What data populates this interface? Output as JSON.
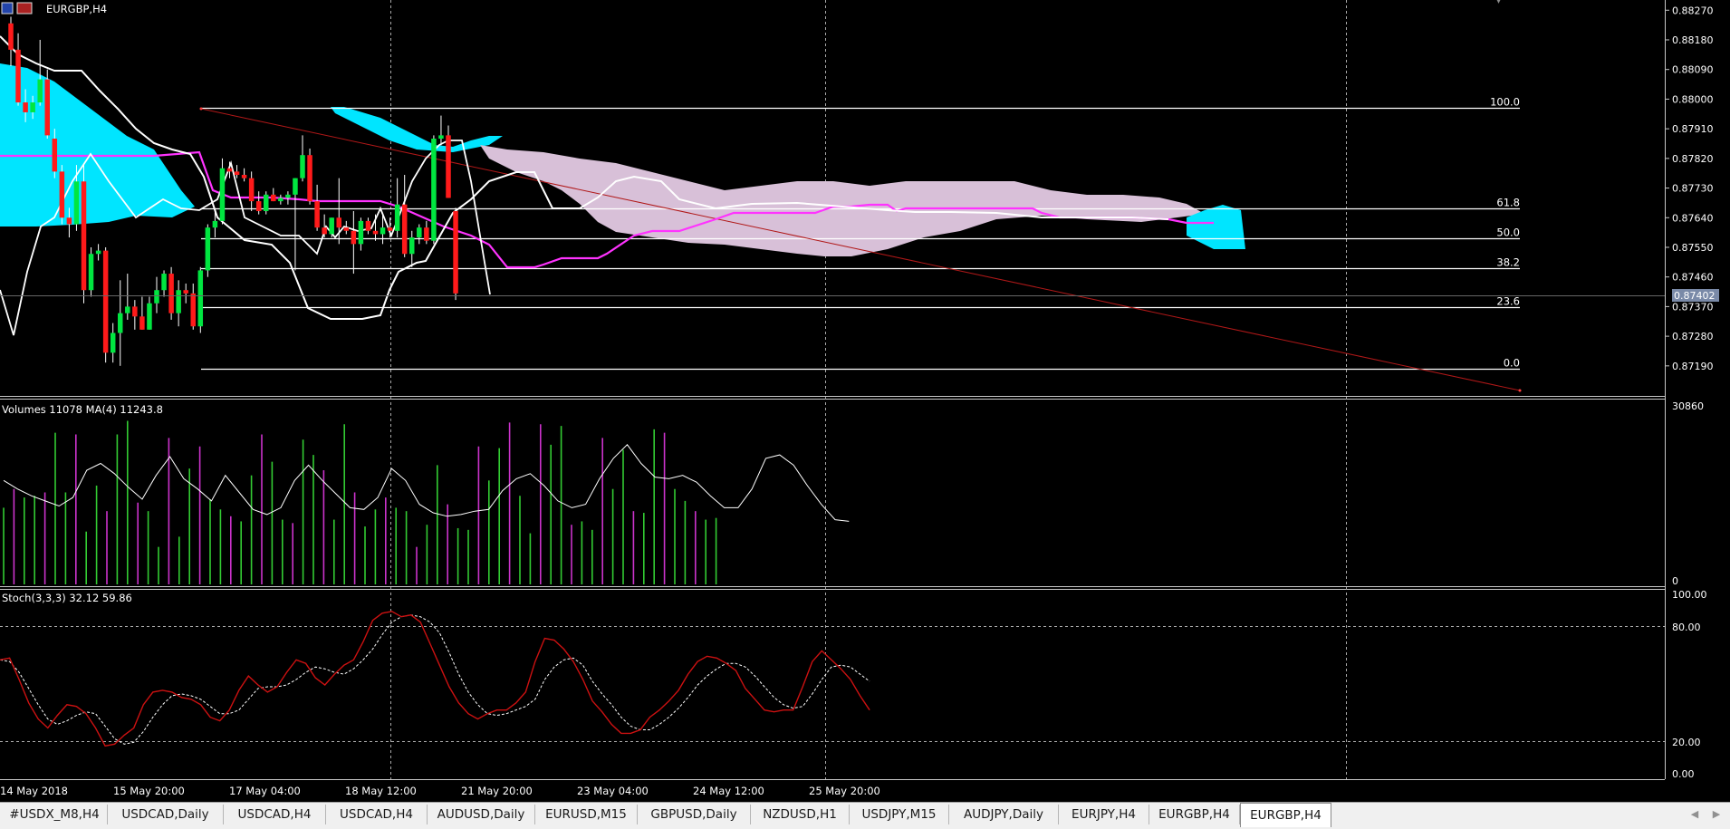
{
  "window": {
    "title": "EURGBP,H4"
  },
  "price_axis": {
    "labels": [
      "0.88270",
      "0.88180",
      "0.88090",
      "0.88000",
      "0.87910",
      "0.87820",
      "0.87730",
      "0.87640",
      "0.87550",
      "0.87460",
      "0.87370",
      "0.87280",
      "0.87190"
    ],
    "current_price": "0.87402"
  },
  "fib_levels": [
    {
      "label": "100.0",
      "value": 0.87973
    },
    {
      "label": "61.8",
      "value": 0.87669
    },
    {
      "label": "50.0",
      "value": 0.87577
    },
    {
      "label": "38.2",
      "value": 0.87486
    },
    {
      "label": "23.6",
      "value": 0.87367
    },
    {
      "label": "0.0",
      "value": 0.8718
    }
  ],
  "volume_panel": {
    "label": "Volumes 11078 MA(4) 11243.8",
    "max_label": "30860",
    "min_label": "0"
  },
  "stoch_panel": {
    "label": "Stoch(3,3,3) 32.12 59.86",
    "levels": [
      "100.00",
      "80.00",
      "20.00",
      "0.00"
    ]
  },
  "time_axis": {
    "labels": [
      "14 May 2018",
      "15 May 20:00",
      "17 May 04:00",
      "18 May 12:00",
      "21 May 20:00",
      "23 May 04:00",
      "24 May 12:00",
      "25 May 20:00"
    ]
  },
  "tabs": [
    {
      "label": "#USDX_M8,H4",
      "active": false
    },
    {
      "label": "USDCAD,Daily",
      "active": false
    },
    {
      "label": "USDCAD,H4",
      "active": false
    },
    {
      "label": "USDCAD,H4",
      "active": false
    },
    {
      "label": "AUDUSD,Daily",
      "active": false
    },
    {
      "label": "EURUSD,M15",
      "active": false
    },
    {
      "label": "GBPUSD,Daily",
      "active": false
    },
    {
      "label": "NZDUSD,H1",
      "active": false
    },
    {
      "label": "USDJPY,M15",
      "active": false
    },
    {
      "label": "AUDJPY,Daily",
      "active": false
    },
    {
      "label": "EURJPY,H4",
      "active": false
    },
    {
      "label": "EURGBP,H4",
      "active": false
    },
    {
      "label": "EURGBP,H4",
      "active": true
    }
  ],
  "colors": {
    "bull": "#00e640",
    "bear": "#ff1a1a",
    "kumo_bull": "#00e5ff",
    "kumo_bear": "#d8c0d8",
    "kijun": "#ff33ff",
    "fib_line": "#ffffff",
    "trend_line": "#b01818",
    "volume_up": "#33cc33",
    "volume_down": "#cc33cc",
    "stoch_main": "#cc1111",
    "stoch_signal": "#ffffff"
  },
  "chart_data": {
    "type": "candlestick",
    "title": "EURGBP,H4",
    "ylim": [
      0.8714,
      0.8829
    ],
    "candles": [
      {
        "o": 0.8823,
        "h": 0.8825,
        "l": 0.881,
        "c": 0.8815
      },
      {
        "o": 0.8815,
        "h": 0.882,
        "l": 0.8798,
        "c": 0.8799
      },
      {
        "o": 0.8799,
        "h": 0.8803,
        "l": 0.8793,
        "c": 0.8796
      },
      {
        "o": 0.8796,
        "h": 0.8801,
        "l": 0.8794,
        "c": 0.8799
      },
      {
        "o": 0.8799,
        "h": 0.8818,
        "l": 0.8798,
        "c": 0.8806
      },
      {
        "o": 0.8806,
        "h": 0.8809,
        "l": 0.8788,
        "c": 0.8789
      },
      {
        "o": 0.8788,
        "h": 0.8791,
        "l": 0.8776,
        "c": 0.8778
      },
      {
        "o": 0.8778,
        "h": 0.878,
        "l": 0.8762,
        "c": 0.8764
      },
      {
        "o": 0.8764,
        "h": 0.8767,
        "l": 0.8758,
        "c": 0.8762
      },
      {
        "o": 0.8762,
        "h": 0.878,
        "l": 0.876,
        "c": 0.8775
      },
      {
        "o": 0.8775,
        "h": 0.878,
        "l": 0.8738,
        "c": 0.8742
      },
      {
        "o": 0.8742,
        "h": 0.8755,
        "l": 0.874,
        "c": 0.8753
      },
      {
        "o": 0.8753,
        "h": 0.8756,
        "l": 0.8751,
        "c": 0.8754
      },
      {
        "o": 0.8754,
        "h": 0.8755,
        "l": 0.872,
        "c": 0.8723
      },
      {
        "o": 0.8723,
        "h": 0.8732,
        "l": 0.872,
        "c": 0.8729
      },
      {
        "o": 0.8729,
        "h": 0.8745,
        "l": 0.8719,
        "c": 0.8735
      },
      {
        "o": 0.8735,
        "h": 0.8747,
        "l": 0.8733,
        "c": 0.8737
      },
      {
        "o": 0.8737,
        "h": 0.8739,
        "l": 0.873,
        "c": 0.8734
      },
      {
        "o": 0.8734,
        "h": 0.874,
        "l": 0.873,
        "c": 0.873
      },
      {
        "o": 0.873,
        "h": 0.874,
        "l": 0.873,
        "c": 0.8738
      },
      {
        "o": 0.8738,
        "h": 0.8746,
        "l": 0.8735,
        "c": 0.8742
      },
      {
        "o": 0.8742,
        "h": 0.8748,
        "l": 0.874,
        "c": 0.8747
      },
      {
        "o": 0.8747,
        "h": 0.8749,
        "l": 0.8733,
        "c": 0.8735
      },
      {
        "o": 0.8735,
        "h": 0.8745,
        "l": 0.8731,
        "c": 0.8742
      },
      {
        "o": 0.8742,
        "h": 0.8744,
        "l": 0.8738,
        "c": 0.8741
      },
      {
        "o": 0.8741,
        "h": 0.8744,
        "l": 0.873,
        "c": 0.8731
      },
      {
        "o": 0.8731,
        "h": 0.8749,
        "l": 0.8729,
        "c": 0.8748
      },
      {
        "o": 0.8748,
        "h": 0.8762,
        "l": 0.8746,
        "c": 0.8761
      },
      {
        "o": 0.8761,
        "h": 0.8766,
        "l": 0.8758,
        "c": 0.8763
      },
      {
        "o": 0.8763,
        "h": 0.8782,
        "l": 0.8762,
        "c": 0.8779
      },
      {
        "o": 0.8779,
        "h": 0.8781,
        "l": 0.8776,
        "c": 0.8778
      },
      {
        "o": 0.8778,
        "h": 0.878,
        "l": 0.8776,
        "c": 0.8777
      },
      {
        "o": 0.8777,
        "h": 0.8779,
        "l": 0.8775,
        "c": 0.8776
      },
      {
        "o": 0.8776,
        "h": 0.8778,
        "l": 0.8766,
        "c": 0.8769
      },
      {
        "o": 0.8769,
        "h": 0.8772,
        "l": 0.8765,
        "c": 0.8766
      },
      {
        "o": 0.8766,
        "h": 0.8772,
        "l": 0.8765,
        "c": 0.8771
      },
      {
        "o": 0.8771,
        "h": 0.8773,
        "l": 0.8769,
        "c": 0.8769
      },
      {
        "o": 0.8769,
        "h": 0.8771,
        "l": 0.8768,
        "c": 0.877
      },
      {
        "o": 0.877,
        "h": 0.8772,
        "l": 0.8768,
        "c": 0.8771
      },
      {
        "o": 0.8771,
        "h": 0.8776,
        "l": 0.8748,
        "c": 0.8776
      },
      {
        "o": 0.8776,
        "h": 0.8789,
        "l": 0.8775,
        "c": 0.8783
      },
      {
        "o": 0.8783,
        "h": 0.8785,
        "l": 0.8768,
        "c": 0.8769
      },
      {
        "o": 0.8769,
        "h": 0.8774,
        "l": 0.876,
        "c": 0.8761
      },
      {
        "o": 0.8761,
        "h": 0.8765,
        "l": 0.8758,
        "c": 0.8759
      },
      {
        "o": 0.8759,
        "h": 0.8764,
        "l": 0.8758,
        "c": 0.8764
      },
      {
        "o": 0.8764,
        "h": 0.8776,
        "l": 0.8756,
        "c": 0.8761
      },
      {
        "o": 0.8761,
        "h": 0.8763,
        "l": 0.8759,
        "c": 0.876
      },
      {
        "o": 0.876,
        "h": 0.8766,
        "l": 0.8747,
        "c": 0.8756
      },
      {
        "o": 0.8756,
        "h": 0.8764,
        "l": 0.8754,
        "c": 0.8763
      },
      {
        "o": 0.8763,
        "h": 0.8764,
        "l": 0.8759,
        "c": 0.876
      },
      {
        "o": 0.876,
        "h": 0.8765,
        "l": 0.8757,
        "c": 0.8759
      },
      {
        "o": 0.8759,
        "h": 0.8765,
        "l": 0.8756,
        "c": 0.8761
      },
      {
        "o": 0.8761,
        "h": 0.8764,
        "l": 0.8758,
        "c": 0.876
      },
      {
        "o": 0.876,
        "h": 0.8776,
        "l": 0.8758,
        "c": 0.8768
      },
      {
        "o": 0.8768,
        "h": 0.8777,
        "l": 0.8752,
        "c": 0.8753
      },
      {
        "o": 0.8753,
        "h": 0.876,
        "l": 0.8749,
        "c": 0.8758
      },
      {
        "o": 0.8758,
        "h": 0.8762,
        "l": 0.8756,
        "c": 0.8761
      },
      {
        "o": 0.8761,
        "h": 0.8763,
        "l": 0.8756,
        "c": 0.8757
      },
      {
        "o": 0.8757,
        "h": 0.8789,
        "l": 0.8756,
        "c": 0.8788
      },
      {
        "o": 0.8788,
        "h": 0.8795,
        "l": 0.8786,
        "c": 0.8789
      },
      {
        "o": 0.8789,
        "h": 0.8792,
        "l": 0.877,
        "c": 0.877
      },
      {
        "o": 0.8766,
        "h": 0.8767,
        "l": 0.8739,
        "c": 0.8741
      }
    ],
    "volumes": [
      0.45,
      0.56,
      0.51,
      0.52,
      0.54,
      0.89,
      0.54,
      0.88,
      0.31,
      0.58,
      0.43,
      0.88,
      0.96,
      0.48,
      0.43,
      0.22,
      0.86,
      0.28,
      0.68,
      0.81,
      0.5,
      0.44,
      0.4,
      0.37,
      0.64,
      0.88,
      0.72,
      0.38,
      0.36,
      0.85,
      0.76,
      0.67,
      0.38,
      0.94,
      0.54,
      0.34,
      0.44,
      0.51,
      0.45,
      0.43,
      0.22,
      0.35,
      0.7,
      0.47,
      0.33,
      0.32,
      0.81,
      0.61,
      0.8,
      0.95,
      0.52,
      0.3,
      0.94,
      0.82,
      0.93,
      0.35,
      0.37,
      0.32,
      0.86,
      0.56,
      0.79,
      0.43,
      0.42,
      0.91,
      0.89,
      0.56,
      0.49,
      0.43,
      0.38,
      0.39
    ],
    "volume_ma": [
      0.61,
      0.56,
      0.52,
      0.49,
      0.46,
      0.51,
      0.67,
      0.71,
      0.65,
      0.57,
      0.5,
      0.64,
      0.75,
      0.62,
      0.56,
      0.49,
      0.64,
      0.54,
      0.44,
      0.41,
      0.45,
      0.61,
      0.7,
      0.61,
      0.53,
      0.45,
      0.44,
      0.51,
      0.68,
      0.61,
      0.47,
      0.42,
      0.4,
      0.41,
      0.43,
      0.44,
      0.55,
      0.62,
      0.65,
      0.58,
      0.49,
      0.45,
      0.47,
      0.62,
      0.74,
      0.82,
      0.71,
      0.63,
      0.62,
      0.64,
      0.6,
      0.52,
      0.45,
      0.45,
      0.56,
      0.74,
      0.76,
      0.7,
      0.58,
      0.47,
      0.38,
      0.37
    ],
    "stoch_main": [
      63,
      64,
      52,
      39,
      30,
      25,
      32,
      38,
      37,
      33,
      25,
      15,
      16,
      21,
      25,
      38,
      45,
      46,
      45,
      42,
      41,
      38,
      31,
      29,
      35,
      46,
      54,
      49,
      45,
      48,
      56,
      63,
      61,
      53,
      49,
      55,
      60,
      63,
      73,
      85,
      89,
      90,
      87,
      88,
      84,
      72,
      60,
      48,
      39,
      33,
      30,
      33,
      35,
      35,
      39,
      45,
      62,
      75,
      74,
      69,
      62,
      52,
      40,
      34,
      27,
      22,
      22,
      24,
      31,
      35,
      40,
      46,
      55,
      62,
      65,
      64,
      61,
      57,
      47,
      41,
      35,
      34,
      35,
      35,
      48,
      62,
      68,
      63,
      58,
      52,
      43,
      35
    ],
    "stoch_signal": [
      63,
      62,
      56,
      47,
      38,
      30,
      27,
      29,
      32,
      34,
      33,
      26,
      19,
      16,
      17,
      23,
      31,
      38,
      43,
      44,
      43,
      41,
      37,
      33,
      33,
      35,
      41,
      47,
      48,
      48,
      49,
      52,
      56,
      59,
      58,
      56,
      55,
      58,
      63,
      69,
      77,
      84,
      87,
      88,
      87,
      84,
      78,
      67,
      55,
      45,
      38,
      33,
      32,
      33,
      35,
      37,
      41,
      52,
      59,
      63,
      64,
      60,
      51,
      44,
      38,
      31,
      26,
      24,
      24,
      27,
      31,
      36,
      42,
      49,
      54,
      58,
      61,
      61,
      59,
      54,
      48,
      42,
      38,
      36,
      37,
      44,
      52,
      59,
      60,
      59,
      55,
      51
    ],
    "current_price": 0.87402
  }
}
